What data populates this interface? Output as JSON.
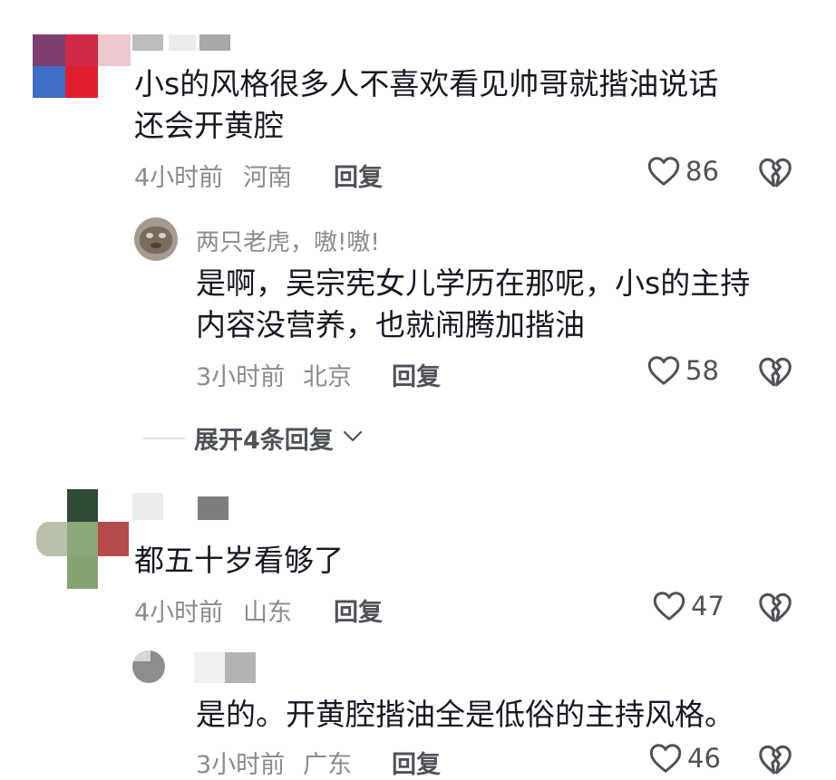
{
  "comments": [
    {
      "username": "",
      "text_lines": [
        "小s的风格很多人不喜欢看见帅哥就揩油说话",
        "还会开黄腔"
      ],
      "time": "4小时前",
      "location": "河南",
      "reply_label": "回复",
      "likes": "86",
      "replies": [
        {
          "username": "两只老虎，嗷!嗷!",
          "text_lines": [
            "是啊，吴宗宪女儿学历在那呢，小s的主持",
            "内容没营养，也就闹腾加揩油"
          ],
          "time": "3小时前",
          "location": "北京",
          "reply_label": "回复",
          "likes": "58"
        }
      ],
      "expand_label": "展开4条回复"
    },
    {
      "username": "",
      "text_lines": [
        "都五十岁看够了"
      ],
      "time": "4小时前",
      "location": "山东",
      "reply_label": "回复",
      "likes": "47",
      "replies": [
        {
          "username": "",
          "text_lines": [
            "是的。开黄腔揩油全是低俗的主持风格。"
          ],
          "time": "3小时前",
          "location": "广东",
          "reply_label": "回复",
          "likes": "46"
        }
      ]
    }
  ],
  "icons": {
    "like": "heart-outline-icon",
    "dislike": "broken-heart-icon",
    "expand": "chevron-down-icon"
  },
  "colors": {
    "text_primary": "#161823",
    "text_secondary": "#8a8b91",
    "icon": "#505259"
  }
}
